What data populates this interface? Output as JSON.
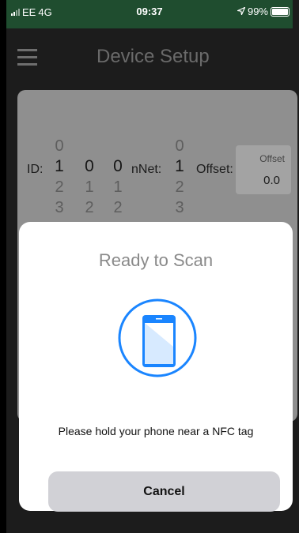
{
  "status_bar": {
    "carrier": "EE",
    "network": "4G",
    "time": "09:37",
    "location_icon": "location-arrow-icon",
    "battery": "99%"
  },
  "navbar": {
    "title": "Device Setup",
    "menu_icon": "hamburger-icon"
  },
  "form": {
    "id_label": "ID:",
    "id_pickers": [
      {
        "above": "0",
        "selected": "1",
        "below1": "2",
        "below2": "3"
      },
      {
        "above": "",
        "selected": "0",
        "below1": "1",
        "below2": "2"
      },
      {
        "above": "",
        "selected": "0",
        "below1": "1",
        "below2": "2"
      }
    ],
    "nnet_label": "nNet:",
    "nnet_picker": {
      "above": "0",
      "selected": "1",
      "below1": "2",
      "below2": "3"
    },
    "offset_label": "Offset:",
    "offset_placeholder": "Offset",
    "offset_value": "0.0"
  },
  "nfc_sheet": {
    "title": "Ready to Scan",
    "icon": "phone-nfc-icon",
    "accent_color": "#1a85ff",
    "instruction": "Please hold your phone near a NFC tag",
    "cancel_label": "Cancel"
  }
}
